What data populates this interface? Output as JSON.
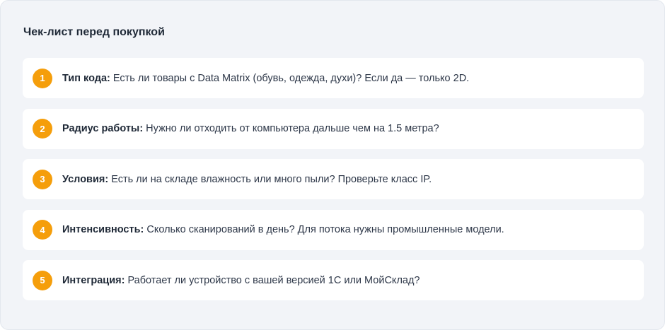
{
  "checklist": {
    "title": "Чек-лист перед покупкой",
    "items": [
      {
        "number": "1",
        "label": "Тип кода:",
        "text": " Есть ли товары с Data Matrix (обувь, одежда, духи)? Если да — только 2D."
      },
      {
        "number": "2",
        "label": "Радиус работы:",
        "text": " Нужно ли отходить от компьютера дальше чем на 1.5 метра?"
      },
      {
        "number": "3",
        "label": "Условия:",
        "text": " Есть ли на складе влажность или много пыли? Проверьте класс IP."
      },
      {
        "number": "4",
        "label": "Интенсивность:",
        "text": " Сколько сканирований в день? Для потока нужны промышленные модели."
      },
      {
        "number": "5",
        "label": "Интеграция:",
        "text": " Работает ли устройство с вашей версией 1С или МойСклад?"
      }
    ]
  },
  "colors": {
    "badge": "#f59e0b",
    "panel_background": "#f2f4f8",
    "card_background": "#ffffff"
  }
}
